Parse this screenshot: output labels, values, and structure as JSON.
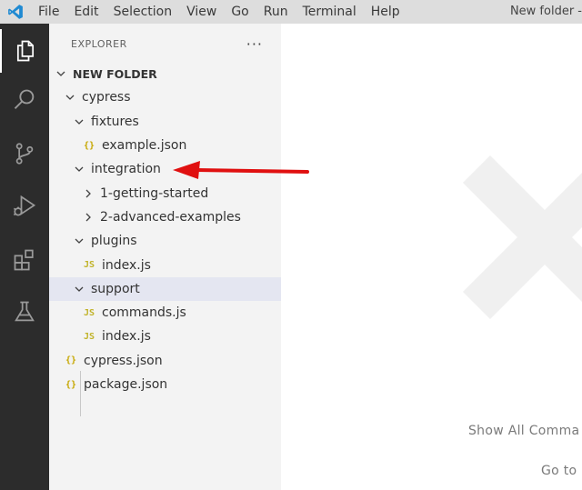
{
  "menubar": {
    "items": [
      "File",
      "Edit",
      "Selection",
      "View",
      "Go",
      "Run",
      "Terminal",
      "Help"
    ],
    "window_title": "New folder - "
  },
  "activitybar": {
    "items": [
      {
        "name": "explorer",
        "icon": "files-icon"
      },
      {
        "name": "search",
        "icon": "search-icon"
      },
      {
        "name": "source-control",
        "icon": "source-control-icon"
      },
      {
        "name": "run-debug",
        "icon": "run-debug-icon"
      },
      {
        "name": "extensions",
        "icon": "extensions-icon"
      },
      {
        "name": "testing",
        "icon": "beaker-icon"
      }
    ]
  },
  "sidebar": {
    "title": "EXPLORER",
    "more_actions": "···",
    "root": "NEW FOLDER",
    "tree": [
      {
        "label": "cypress",
        "kind": "folder",
        "depth": 1,
        "expanded": true
      },
      {
        "label": "fixtures",
        "kind": "folder",
        "depth": 2,
        "expanded": true
      },
      {
        "label": "example.json",
        "kind": "json",
        "depth": 3
      },
      {
        "label": "integration",
        "kind": "folder",
        "depth": 2,
        "expanded": true
      },
      {
        "label": "1-getting-started",
        "kind": "folder",
        "depth": 3,
        "expanded": false
      },
      {
        "label": "2-advanced-examples",
        "kind": "folder",
        "depth": 3,
        "expanded": false
      },
      {
        "label": "plugins",
        "kind": "folder",
        "depth": 2,
        "expanded": true
      },
      {
        "label": "index.js",
        "kind": "js",
        "depth": 3
      },
      {
        "label": "support",
        "kind": "folder",
        "depth": 2,
        "expanded": true,
        "selected": true
      },
      {
        "label": "commands.js",
        "kind": "js",
        "depth": 3
      },
      {
        "label": "index.js",
        "kind": "js",
        "depth": 3
      },
      {
        "label": "cypress.json",
        "kind": "json",
        "depth": 1
      },
      {
        "label": "package.json",
        "kind": "json",
        "depth": 1
      }
    ]
  },
  "editor": {
    "hint_show_all": "Show All Comma",
    "hint_go_to": "Go to"
  },
  "icons": {
    "json": "{}",
    "js": "JS"
  },
  "colors": {
    "activitybar": "#2c2c2c",
    "sidebar": "#f3f3f3",
    "selection": "#e4e6f1",
    "accent": "#0065a9",
    "annotation_arrow": "#e01010"
  }
}
